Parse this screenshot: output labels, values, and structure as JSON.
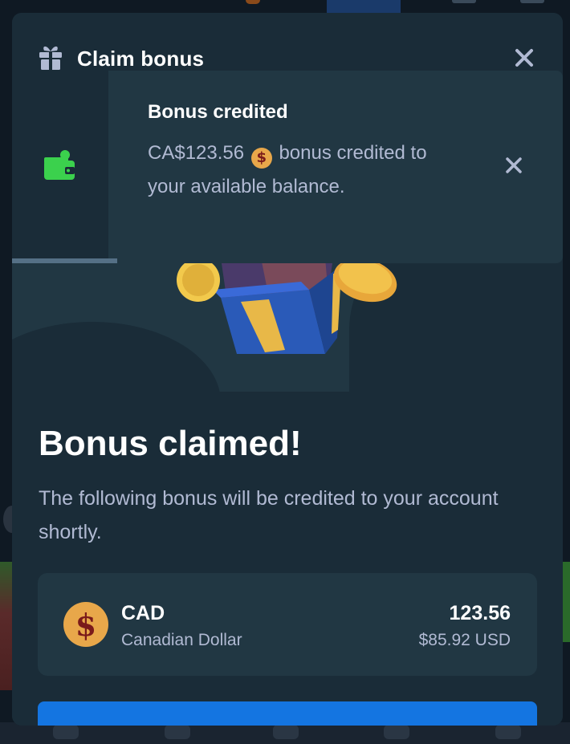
{
  "modal": {
    "title": "Claim bonus",
    "icon": "gift-icon",
    "close_icon": "close-icon"
  },
  "toast": {
    "title": "Bonus credited",
    "amount": "CA$123.56",
    "coin_symbol": "$",
    "message_suffix": "bonus credited to your available balance.",
    "icon": "wallet-icon",
    "accent_color": "#3bd14d"
  },
  "content": {
    "heading": "Bonus claimed!",
    "description": "The following bonus will be credited to your account shortly."
  },
  "currency": {
    "coin_symbol": "$",
    "code": "CAD",
    "name": "Canadian Dollar",
    "amount": "123.56",
    "usd_value": "$85.92 USD"
  },
  "colors": {
    "modal_bg": "#1a2c38",
    "card_bg": "#213743",
    "primary_button": "#1475e1",
    "muted_text": "#b1bad3",
    "coin": "#e8a74a"
  }
}
